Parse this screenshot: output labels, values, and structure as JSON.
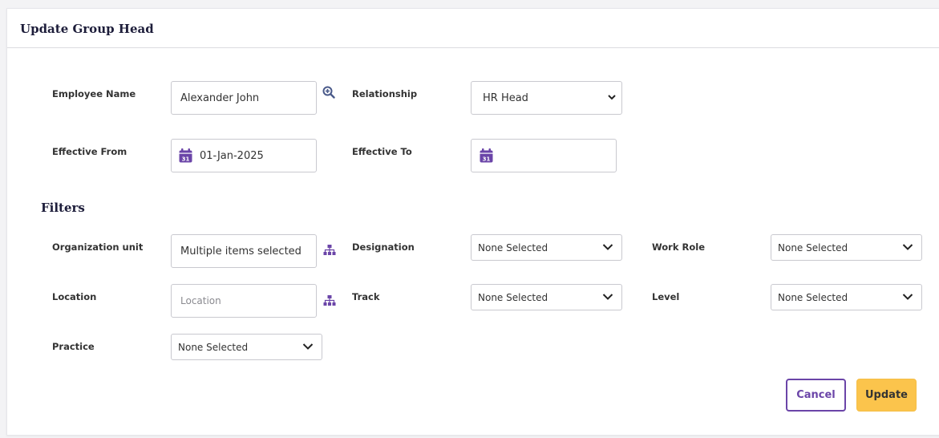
{
  "header": {
    "title": "Update Group Head"
  },
  "form": {
    "employee_name": {
      "label": "Employee Name",
      "value": "Alexander John"
    },
    "relationship": {
      "label": "Relationship",
      "value": "HR Head"
    },
    "effective_from": {
      "label": "Effective From",
      "value": "01-Jan-2025"
    },
    "effective_to": {
      "label": "Effective To",
      "value": ""
    }
  },
  "filters": {
    "title": "Filters",
    "organization_unit": {
      "label": "Organization unit",
      "value": "Multiple items selected"
    },
    "designation": {
      "label": "Designation",
      "value": "None Selected"
    },
    "work_role": {
      "label": "Work Role",
      "value": "None Selected"
    },
    "location": {
      "label": "Location",
      "placeholder": "Location"
    },
    "track": {
      "label": "Track",
      "value": "None Selected"
    },
    "level": {
      "label": "Level",
      "value": "None Selected"
    },
    "practice": {
      "label": "Practice",
      "value": "None Selected"
    }
  },
  "actions": {
    "cancel": "Cancel",
    "update": "Update"
  },
  "icons": {
    "search": "zoom-in-icon",
    "hierarchy": "org-hierarchy-icon",
    "calendar": "calendar-icon",
    "calendar_day": "31"
  },
  "colors": {
    "accent": "#6b45a8",
    "primary_button": "#fbc44c",
    "icon": "#6b45a8"
  }
}
